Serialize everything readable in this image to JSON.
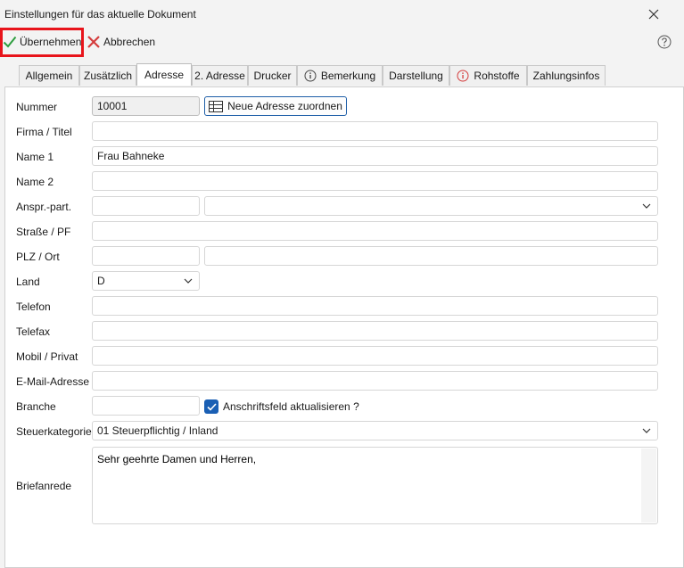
{
  "window": {
    "title": "Einstellungen für das aktuelle Dokument"
  },
  "toolbar": {
    "apply_label": "Übernehmen",
    "cancel_label": "Abbrechen"
  },
  "tabs": [
    {
      "label": "Allgemein"
    },
    {
      "label": "Zusätzlich"
    },
    {
      "label": "Adresse"
    },
    {
      "label": "2. Adresse"
    },
    {
      "label": "Drucker"
    },
    {
      "label": "Bemerkung"
    },
    {
      "label": "Darstellung"
    },
    {
      "label": "Rohstoffe"
    },
    {
      "label": "Zahlungsinfos"
    }
  ],
  "form": {
    "nummer": {
      "label": "Nummer",
      "value": "10001"
    },
    "assign_button": "Neue Adresse zuordnen",
    "firma": {
      "label": "Firma / Titel",
      "value": ""
    },
    "name1": {
      "label": "Name 1",
      "value": "Frau Bahneke"
    },
    "name2": {
      "label": "Name 2",
      "value": ""
    },
    "anspr": {
      "label": "Anspr.-part.",
      "value": "",
      "select_value": ""
    },
    "strasse": {
      "label": "Straße / PF",
      "value": ""
    },
    "plz": {
      "label": "PLZ / Ort",
      "plz_value": "",
      "ort_value": ""
    },
    "land": {
      "label": "Land",
      "value": "D"
    },
    "telefon": {
      "label": "Telefon",
      "value": ""
    },
    "telefax": {
      "label": "Telefax",
      "value": ""
    },
    "mobil": {
      "label": "Mobil / Privat",
      "value": ""
    },
    "email": {
      "label": "E-Mail-Adresse",
      "value": ""
    },
    "branche": {
      "label": "Branche",
      "value": ""
    },
    "anschrift_checkbox": {
      "label": "Anschriftsfeld aktualisieren ?",
      "checked": true
    },
    "steuer": {
      "label": "Steuerkategorie",
      "value": "01 Steuerpflichtig / Inland"
    },
    "briefanrede": {
      "label": "Briefanrede",
      "value": "Sehr geehrte Damen und Herren,"
    }
  },
  "colors": {
    "accent": "#1a5fb4",
    "highlight": "#e8141b",
    "apply_check": "#2e9e3f",
    "cancel_x": "#d43c3c"
  }
}
